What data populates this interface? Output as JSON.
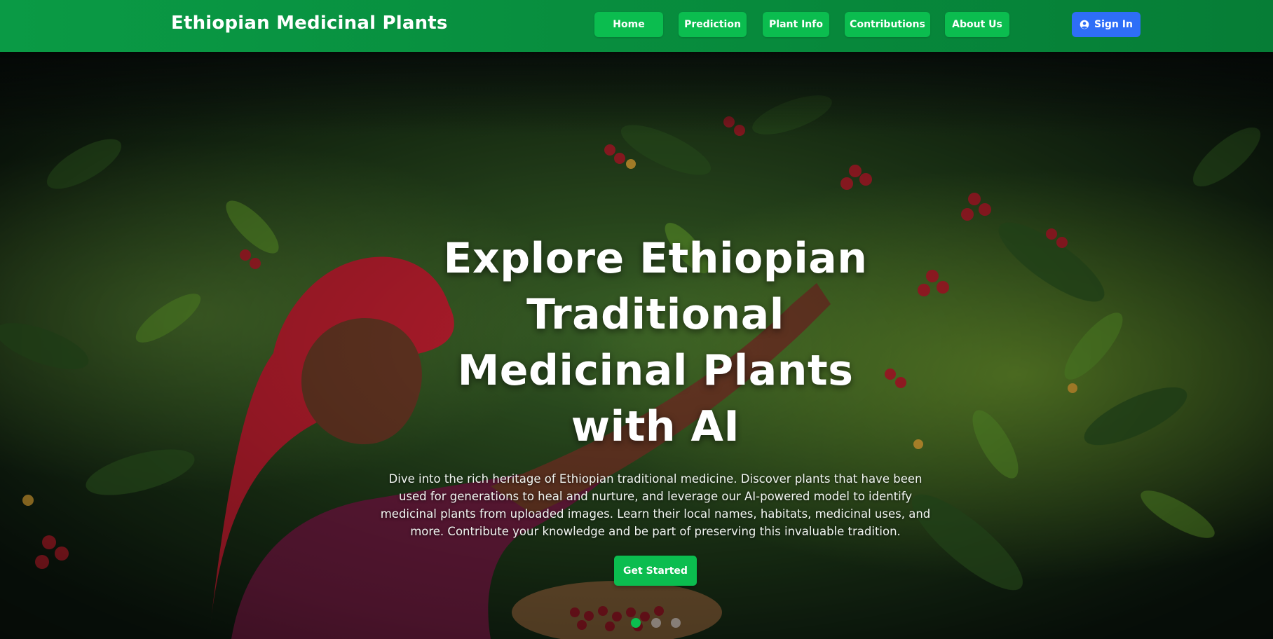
{
  "brand": {
    "title": "Ethiopian Medicinal Plants"
  },
  "nav": {
    "items": [
      {
        "label": "Home"
      },
      {
        "label": "Prediction"
      },
      {
        "label": "Plant Info"
      },
      {
        "label": "Contributions"
      },
      {
        "label": "About Us"
      }
    ],
    "signin_label": "Sign In",
    "signin_icon": "user-circle-icon"
  },
  "hero": {
    "title": "Explore Ethiopian Traditional Medicinal Plants with AI",
    "description": "Dive into the rich heritage of Ethiopian traditional medicine. Discover plants that have been used for generations to heal and nurture, and leverage our AI-powered model to identify medicinal plants from uploaded images. Learn their local names, habitats, medicinal uses, and more. Contribute your knowledge and be part of preserving this invaluable tradition.",
    "cta_label": "Get Started",
    "background": "photo of a woman in a red headscarf harvesting red coffee cherries",
    "slides_total": 3,
    "active_slide": 1
  },
  "colors": {
    "navbar": "#078a3c",
    "nav_button": "#0bbd4f",
    "signin_button": "#2e6ef7",
    "text": "#ffffff",
    "dot_inactive": "#b4b4be"
  }
}
